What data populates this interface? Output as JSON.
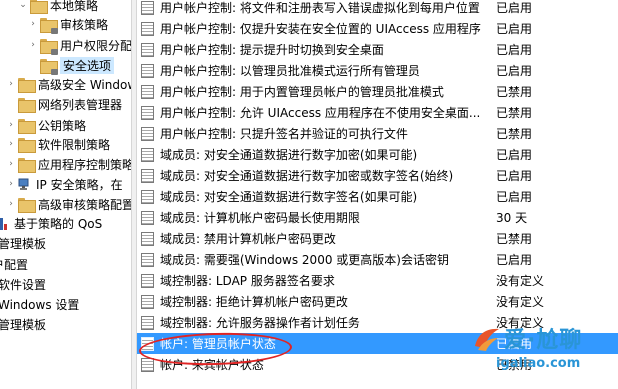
{
  "tree": {
    "items": [
      {
        "label": "本地策略",
        "expander": "⌄",
        "icon": "folder-open-icon"
      },
      {
        "label": "审核策略",
        "expander": "›",
        "icon": "folder-icon"
      },
      {
        "label": "用户权限分配",
        "expander": "›",
        "icon": "folder-icon"
      },
      {
        "label": "安全选项",
        "expander": "",
        "icon": "folder-icon"
      },
      {
        "label": "高级安全 Windows",
        "expander": "›",
        "icon": "folder-icon"
      },
      {
        "label": "网络列表管理器",
        "expander": "",
        "icon": "folder-icon"
      },
      {
        "label": "公钥策略",
        "expander": "›",
        "icon": "folder-icon"
      },
      {
        "label": "软件限制策略",
        "expander": "›",
        "icon": "folder-icon"
      },
      {
        "label": "应用程序控制策略",
        "expander": "›",
        "icon": "folder-icon"
      },
      {
        "label": "IP 安全策略，在",
        "expander": "›",
        "icon": "ip-security-icon"
      },
      {
        "label": "高级审核策略配置",
        "expander": "›",
        "icon": "folder-icon"
      },
      {
        "label": "基于策略的 QoS",
        "expander": "",
        "icon": "bar-chart-icon"
      },
      {
        "label": "管理模板",
        "expander": "",
        "icon": ""
      },
      {
        "label": "户配置",
        "expander": "",
        "icon": ""
      },
      {
        "label": "软件设置",
        "expander": "",
        "icon": ""
      },
      {
        "label": "Windows 设置",
        "expander": "",
        "icon": ""
      },
      {
        "label": "管理模板",
        "expander": "",
        "icon": ""
      }
    ]
  },
  "policies": [
    {
      "name": "用户帐户控制: 将文件和注册表写入错误虚拟化到每用户位置",
      "value": "已启用"
    },
    {
      "name": "用户帐户控制: 仅提升安装在安全位置的 UIAccess 应用程序",
      "value": "已启用"
    },
    {
      "name": "用户帐户控制: 提示提升时切换到安全桌面",
      "value": "已启用"
    },
    {
      "name": "用户帐户控制: 以管理员批准模式运行所有管理员",
      "value": "已启用"
    },
    {
      "name": "用户帐户控制: 用于内置管理员帐户的管理员批准模式",
      "value": "已禁用"
    },
    {
      "name": "用户帐户控制: 允许 UIAccess 应用程序在不使用安全桌面...",
      "value": "已禁用"
    },
    {
      "name": "用户帐户控制: 只提升签名并验证的可执行文件",
      "value": "已禁用"
    },
    {
      "name": "域成员: 对安全通道数据进行数字加密(如果可能)",
      "value": "已启用"
    },
    {
      "name": "域成员: 对安全通道数据进行数字加密或数字签名(始终)",
      "value": "已启用"
    },
    {
      "name": "域成员: 对安全通道数据进行数字签名(如果可能)",
      "value": "已启用"
    },
    {
      "name": "域成员: 计算机帐户密码最长使用期限",
      "value": "30 天"
    },
    {
      "name": "域成员: 禁用计算机帐户密码更改",
      "value": "已禁用"
    },
    {
      "name": "域成员: 需要强(Windows 2000 或更高版本)会话密钥",
      "value": "已启用"
    },
    {
      "name": "域控制器: LDAP 服务器签名要求",
      "value": "没有定义"
    },
    {
      "name": "域控制器: 拒绝计算机帐户密码更改",
      "value": "没有定义"
    },
    {
      "name": "域控制器: 允许服务器操作者计划任务",
      "value": "没有定义"
    },
    {
      "name": "帐户: 管理员帐户状态",
      "value": "已启用"
    },
    {
      "name": "帐户: 来宾帐户状态",
      "value": "已禁用"
    }
  ],
  "selected_policy_index": 16,
  "watermark": {
    "title": "爱·尬聊",
    "url": "igaliao.com"
  },
  "colors": {
    "selection": "#3399ff",
    "annotation": "#e02424",
    "watermark": "#2a95d6"
  }
}
